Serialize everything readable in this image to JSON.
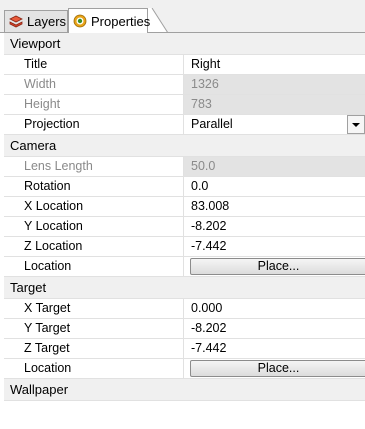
{
  "tabs": [
    {
      "label": "Layers",
      "icon": "layers-icon",
      "active": false
    },
    {
      "label": "Properties",
      "icon": "properties-icon",
      "active": true
    }
  ],
  "sections": {
    "viewport": {
      "title": "Viewport",
      "rows": {
        "title": {
          "label": "Title",
          "value": "Right"
        },
        "width": {
          "label": "Width",
          "value": "1326"
        },
        "height": {
          "label": "Height",
          "value": "783"
        },
        "projection": {
          "label": "Projection",
          "value": "Parallel"
        }
      }
    },
    "camera": {
      "title": "Camera",
      "rows": {
        "lens_length": {
          "label": "Lens Length",
          "value": "50.0"
        },
        "rotation": {
          "label": "Rotation",
          "value": "0.0"
        },
        "x_location": {
          "label": "X Location",
          "value": "83.008"
        },
        "y_location": {
          "label": "Y Location",
          "value": "-8.202"
        },
        "z_location": {
          "label": "Z Location",
          "value": "-7.442"
        },
        "location": {
          "label": "Location",
          "button": "Place..."
        }
      }
    },
    "target": {
      "title": "Target",
      "rows": {
        "x_target": {
          "label": "X Target",
          "value": "0.000"
        },
        "y_target": {
          "label": "Y Target",
          "value": "-8.202"
        },
        "z_target": {
          "label": "Z Target",
          "value": "-7.442"
        },
        "location": {
          "label": "Location",
          "button": "Place..."
        }
      }
    },
    "wallpaper": {
      "title": "Wallpaper"
    }
  },
  "colors": {
    "layers_icon": "#d9442a",
    "properties_icon_outer": "#e8a317",
    "properties_icon_inner": "#3a8f2a",
    "disabled_bg": "#e3e3e3",
    "section_bg": "#f0f0f0"
  }
}
